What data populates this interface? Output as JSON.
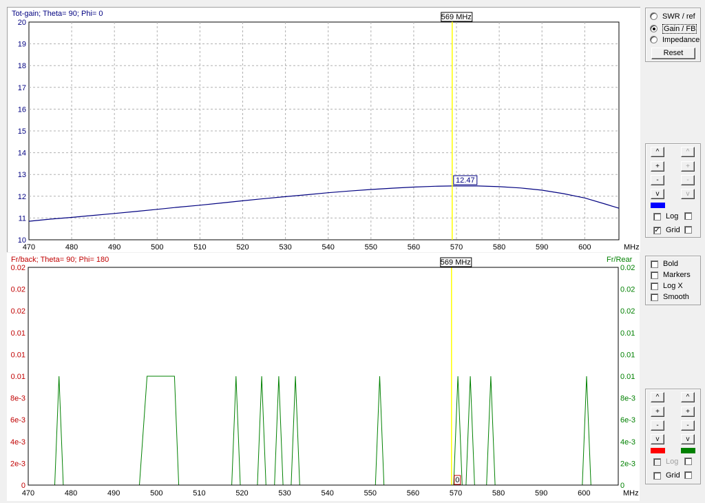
{
  "top_plot": {
    "title": "Tot-gain; Theta= 90; Phi= 0",
    "marker_label": "569 MHz",
    "value_label": "12.47",
    "x_unit": "MHz",
    "y_ticks": [
      "20",
      "19",
      "18",
      "17",
      "16",
      "15",
      "14",
      "13",
      "12",
      "11",
      "10"
    ],
    "x_ticks": [
      "470",
      "480",
      "490",
      "500",
      "510",
      "520",
      "530",
      "540",
      "550",
      "560",
      "570",
      "580",
      "590",
      "600"
    ]
  },
  "bottom_plot": {
    "title": "Fr/back; Theta= 90; Phi= 180",
    "right_title": "Fr/Rear",
    "marker_label": "569 MHz",
    "value_label": "0",
    "x_unit": "MHz",
    "y_ticks": [
      "0.02",
      "0.02",
      "0.02",
      "0.01",
      "0.01",
      "0.01",
      "8e-3",
      "6e-3",
      "4e-3",
      "2e-3",
      "0"
    ],
    "x_ticks": [
      "470",
      "480",
      "490",
      "500",
      "510",
      "520",
      "530",
      "540",
      "550",
      "560",
      "570",
      "580",
      "590",
      "600"
    ]
  },
  "mode_panel": {
    "options": [
      "SWR / ref",
      "Gain / FB",
      "Impedance"
    ],
    "selected": "Gain / FB",
    "reset_label": "Reset"
  },
  "top_controls": {
    "up": "^",
    "plus": "+",
    "minus": "-",
    "down": "v",
    "log_label": "Log",
    "grid_label": "Grid",
    "grid_check": "✓",
    "swatch_color": "#0000ff"
  },
  "options_panel": {
    "bold_label": "Bold",
    "markers_label": "Markers",
    "logx_label": "Log X",
    "smooth_label": "Smooth"
  },
  "bottom_controls": {
    "up": "^",
    "plus": "+",
    "minus": "-",
    "down": "v",
    "log_label": "Log",
    "grid_label": "Grid",
    "swatch_left_color": "#ff0000",
    "swatch_right_color": "#008000"
  },
  "colors": {
    "gain_line": "#000080",
    "fb_line": "#008000",
    "marker_line": "#ffff00",
    "top_axis_text": "#000080",
    "bottom_left_axis_text": "#c00000",
    "bottom_right_axis_text": "#008000"
  },
  "chart_data": [
    {
      "type": "line",
      "title": "Tot-gain; Theta= 90; Phi= 0",
      "xlabel": "MHz",
      "xlim": [
        470,
        608
      ],
      "ylim": [
        10,
        20
      ],
      "grid": true,
      "marker": {
        "x": 569,
        "value": 12.47
      },
      "series": [
        {
          "x": [
            470,
            475,
            480,
            485,
            490,
            495,
            500,
            505,
            510,
            515,
            520,
            525,
            530,
            535,
            540,
            545,
            550,
            555,
            560,
            565,
            569,
            570,
            575,
            580,
            585,
            590,
            595,
            600,
            605,
            608
          ],
          "y": [
            10.85,
            10.95,
            11.03,
            11.12,
            11.21,
            11.3,
            11.4,
            11.5,
            11.59,
            11.69,
            11.79,
            11.89,
            11.98,
            12.07,
            12.16,
            12.24,
            12.31,
            12.37,
            12.42,
            12.46,
            12.47,
            12.47,
            12.47,
            12.44,
            12.38,
            12.28,
            12.12,
            11.92,
            11.63,
            11.45
          ]
        }
      ]
    },
    {
      "type": "line",
      "title": "Fr/back; Theta= 90; Phi= 180",
      "xlabel": "MHz",
      "xlim": [
        470,
        608
      ],
      "ylim": [
        0,
        0.02
      ],
      "grid": false,
      "marker": {
        "x": 569,
        "value": 0
      },
      "series": [
        {
          "name": "Fr/Rear",
          "x": [
            470,
            476.2,
            477.2,
            478.2,
            496,
            497.8,
            504.2,
            505.2,
            517.6,
            518.6,
            519.6,
            523.6,
            524.6,
            525.6,
            527.6,
            528.6,
            529.6,
            531.5,
            532.5,
            533.5,
            551.2,
            552.2,
            553.2,
            569.5,
            570.5,
            571.5,
            572.4,
            573.4,
            574.4,
            577.2,
            578.2,
            579.2,
            599.6,
            600.6,
            601.6,
            608
          ],
          "y": [
            0,
            0,
            0.01,
            0,
            0,
            0.01,
            0.01,
            0,
            0,
            0.01,
            0,
            0,
            0.01,
            0,
            0,
            0.01,
            0,
            0,
            0.01,
            0,
            0,
            0.01,
            0,
            0,
            0.01,
            0,
            0,
            0.01,
            0,
            0,
            0.01,
            0,
            0,
            0.01,
            0,
            0
          ]
        }
      ]
    }
  ]
}
